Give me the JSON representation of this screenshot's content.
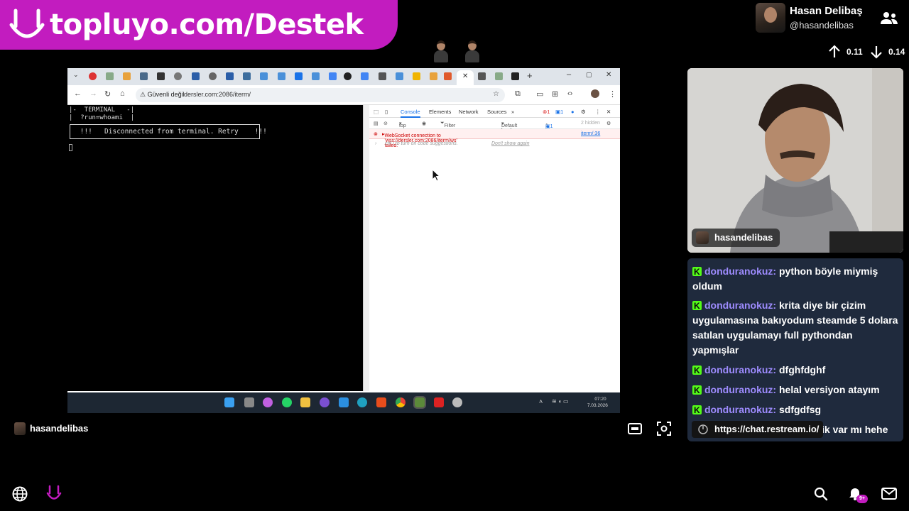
{
  "banner": {
    "url_text": "topluyo.com/Destek"
  },
  "profile": {
    "name": "Hasan Delibaş",
    "handle": "@hasandelibas"
  },
  "votes": {
    "up": "0.11",
    "down": "0.14"
  },
  "browser": {
    "address": {
      "security_label": "Güvenli değil",
      "url": "dersler.com:2086/iterm/"
    },
    "terminal": {
      "line1": "|-  TERMINAL   -|",
      "line2": "|  ?run=whoami  |",
      "box_text": " !!!   Disconnected from terminal. Retry    !!!"
    },
    "devtools": {
      "tabs": [
        "Console",
        "Elements",
        "Network",
        "Sources"
      ],
      "top_label": "top",
      "filter_placeholder": "Filter",
      "levels": "Default levels",
      "issues": "1 issue:",
      "hidden": "2 hidden",
      "error_text": "WebSocket connection to 'wss://dersler.com:2086/iterm/ws' failed:",
      "error_source": "iterm/:36",
      "hint_text": "ctrl  i  to turn on code suggestions.",
      "hint_link": "Don't show again"
    },
    "taskbar": {
      "time": "07:20",
      "date": "7.03.2026"
    }
  },
  "webcam": {
    "label": "hasandelibas"
  },
  "chat": {
    "messages": [
      {
        "user": "donduranokuz:",
        "text": "python böyle miymiş oldum"
      },
      {
        "user": "donduranokuz:",
        "text": "krita diye bir çizim uygulamasına bakıyodum steamde 5 dolara satılan uygulamayı full pythondan yapmışlar"
      },
      {
        "user": "donduranokuz:",
        "text": "dfghfdghf"
      },
      {
        "user": "donduranokuz:",
        "text": "helal versiyon atayım"
      },
      {
        "user": "donduranokuz:",
        "text": "sdfgdfsg"
      }
    ],
    "restream_link": "https://chat.restream.io/",
    "tail_text": "zik var mı hehe"
  },
  "footer": {
    "streamer": "hasandelibas",
    "notification_badge": "9+"
  },
  "colors": {
    "brand": "#c21cbf",
    "chat_bg": "#1f2a3d",
    "chat_user": "#9e8cff",
    "kick_green": "#53fc18"
  }
}
